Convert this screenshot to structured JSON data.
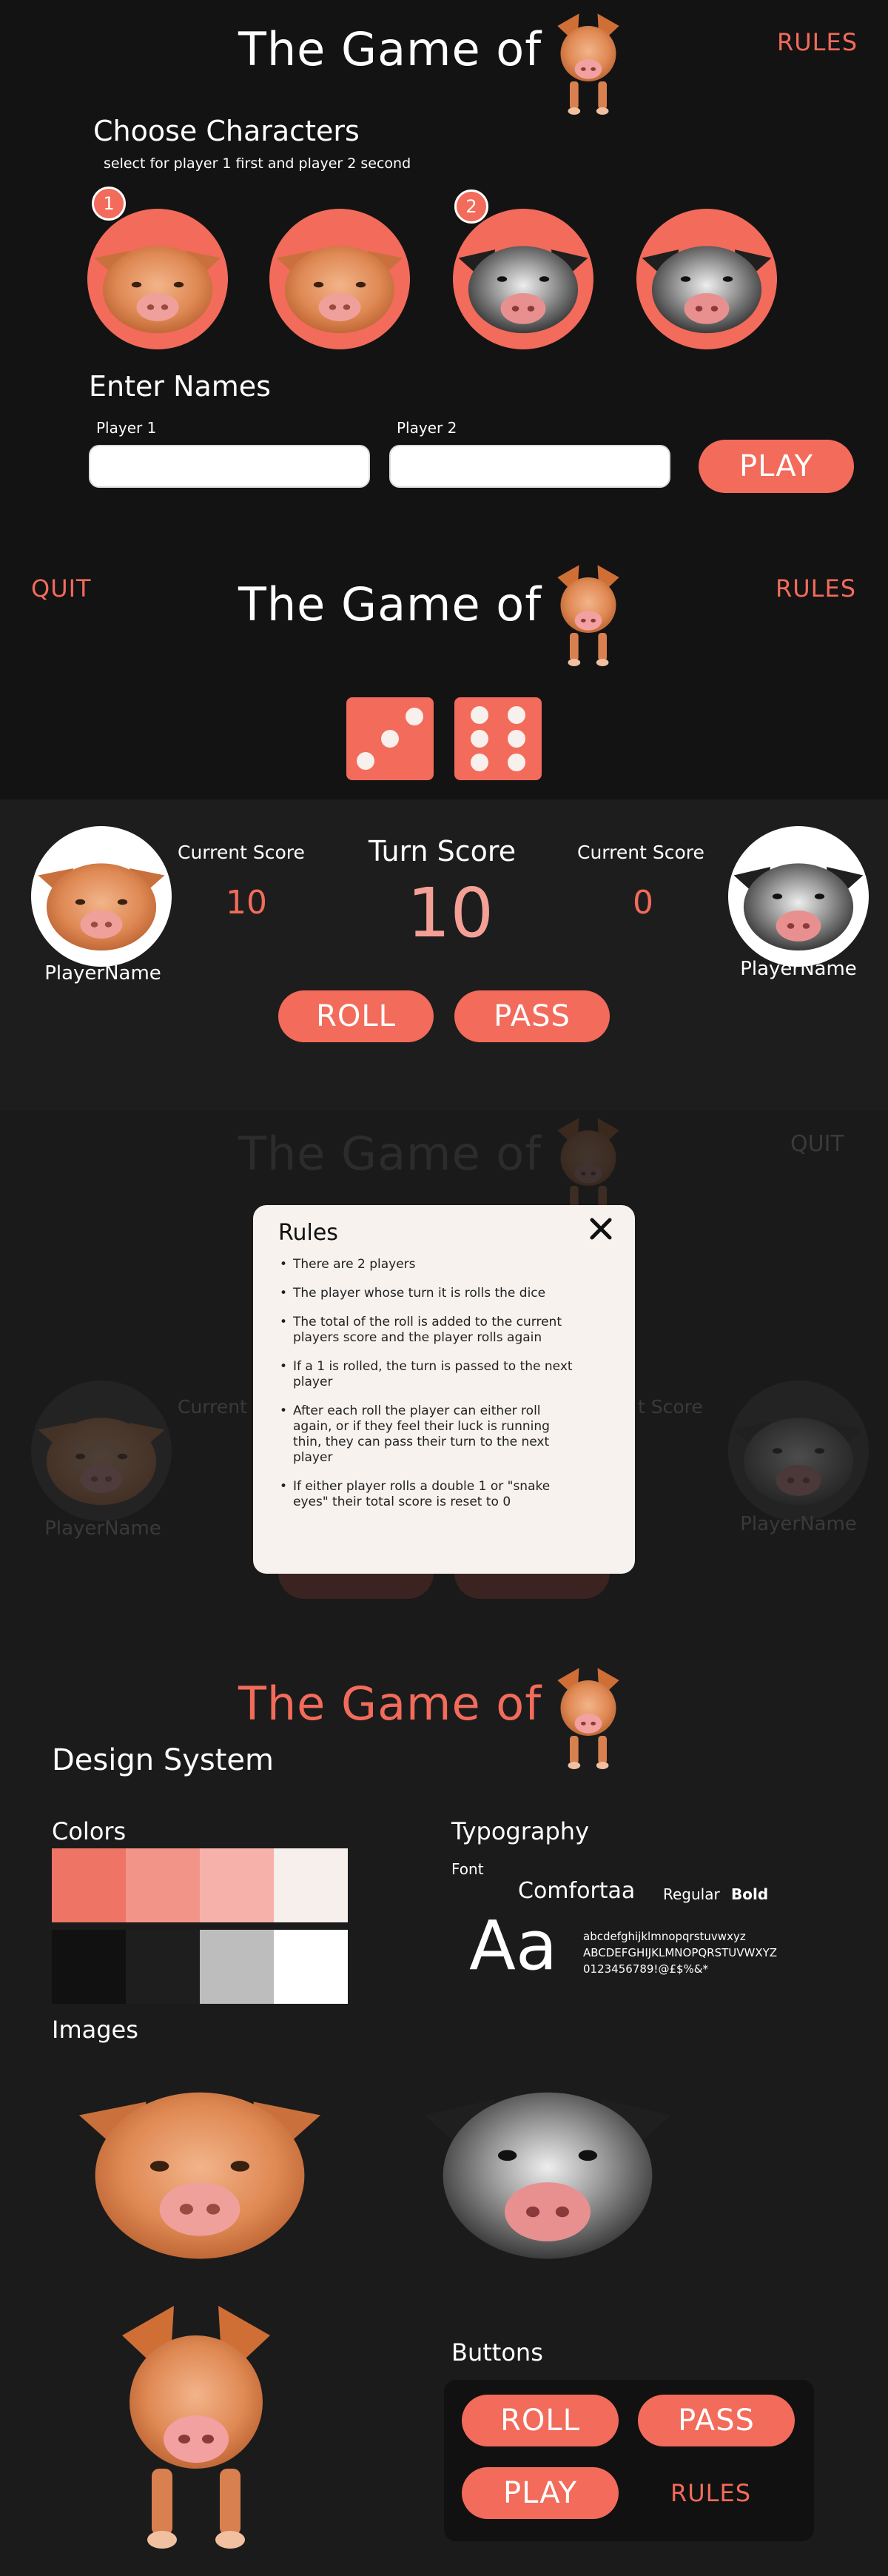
{
  "app_title": "The Game of",
  "colors": {
    "accent": "#f26b5b",
    "bg": "#131313",
    "panel": "#1d1d1d"
  },
  "select_screen": {
    "rules_label": "RULES",
    "choose_heading": "Choose Characters",
    "choose_sub": "select for player 1 first and player 2 second",
    "badges": [
      "1",
      "2"
    ],
    "names_heading": "Enter Names",
    "player1_label": "Player 1",
    "player2_label": "Player 2",
    "play_label": "PLAY"
  },
  "game_screen": {
    "quit_label": "QUIT",
    "rules_label": "RULES",
    "dice": [
      3,
      6
    ],
    "current_score_label": "Current Score",
    "turn_score_label": "Turn Score",
    "player1_score": "10",
    "turn_score": "10",
    "player2_score": "0",
    "player1_name": "PlayerName",
    "player2_name": "PlayerName",
    "roll_label": "ROLL",
    "pass_label": "PASS"
  },
  "rules_modal": {
    "bg_quit_label": "QUIT",
    "bg_score_fragment": "Current",
    "bg_score_fragment2": "t Score",
    "bg_player_name": "PlayerName",
    "title": "Rules",
    "close_icon": "close-icon",
    "items": [
      "There are 2 players",
      "The player whose turn it is rolls the dice",
      "The total of the roll is added to the current players score and the player rolls again",
      "If a 1 is rolled, the turn is passed to the next player",
      "After each roll the player can either roll again, or if they feel their luck is running thin, they can pass their turn to the next player",
      "If either player rolls a double 1 or \"snake eyes\" their total score is reset to 0"
    ]
  },
  "design_system": {
    "heading": "Design System",
    "colors_heading": "Colors",
    "swatches_row1": [
      "#ee7566",
      "#f39489",
      "#f6b2aa",
      "#f6efeb"
    ],
    "swatches_row2": [
      "#111111",
      "#1e1e1e",
      "#bdbdbd",
      "#ffffff"
    ],
    "typography_heading": "Typography",
    "font_label": "Font",
    "font_name": "Comfortaa",
    "regular_label": "Regular",
    "bold_label": "Bold",
    "sample_big": "Aa",
    "sample_lower": "abcdefghijklmnopqrstuvwxyz",
    "sample_upper": "ABCDEFGHIJKLMNOPQRSTUVWXYZ",
    "sample_digits": "0123456789!@£$%&*",
    "images_heading": "Images",
    "buttons_heading": "Buttons",
    "roll_label": "ROLL",
    "pass_label": "PASS",
    "play_label": "PLAY",
    "rules_label": "RULES"
  }
}
